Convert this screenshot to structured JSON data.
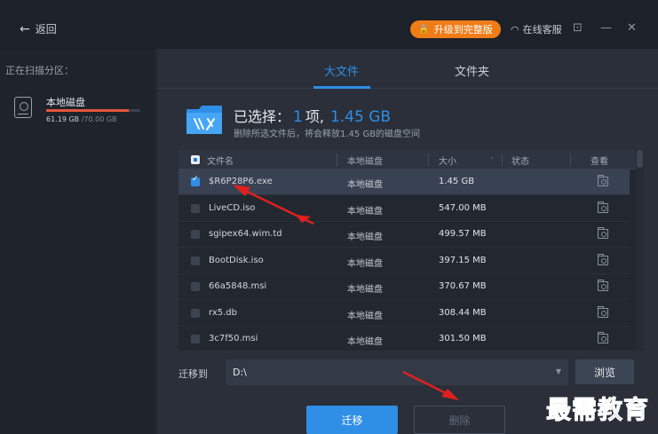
{
  "titlebar": {
    "back_label": "返回",
    "upgrade_label": "升级到完整版",
    "service_label": "在线客服"
  },
  "left_panel": {
    "scan_title": "正在扫描分区：",
    "disk": {
      "name": "本地磁盘",
      "used": "61.19 GB",
      "total": "/70.00 GB",
      "usage_fraction": 0.874
    }
  },
  "tabs": [
    {
      "label": "大文件",
      "active": true
    },
    {
      "label": "文件夹",
      "active": false
    }
  ],
  "selection": {
    "prefix": "已选择：",
    "count": "1",
    "unit": "项,",
    "size": "1.45 GB",
    "note": "删除所选文件后，将会释放1.45 GB的磁盘空间"
  },
  "table": {
    "headers": {
      "name": "文件名",
      "location": "本地磁盘",
      "size": "大小",
      "status": "状态",
      "view": "查看"
    },
    "rows": [
      {
        "name": "$R6P28P6.exe",
        "location": "本地磁盘",
        "size": "1.45 GB",
        "checked": true
      },
      {
        "name": "LiveCD.iso",
        "location": "本地磁盘",
        "size": "547.00 MB",
        "checked": false
      },
      {
        "name": "sgipex64.wim.td",
        "location": "本地磁盘",
        "size": "499.57 MB",
        "checked": false
      },
      {
        "name": "BootDisk.iso",
        "location": "本地磁盘",
        "size": "397.15 MB",
        "checked": false
      },
      {
        "name": "66a5848.msi",
        "location": "本地磁盘",
        "size": "370.67 MB",
        "checked": false
      },
      {
        "name": "rx5.db",
        "location": "本地磁盘",
        "size": "308.44 MB",
        "checked": false
      },
      {
        "name": "3c7f50.msi",
        "location": "本地磁盘",
        "size": "301.50 MB",
        "checked": false
      }
    ]
  },
  "move": {
    "label": "迁移到",
    "path": "D:\\",
    "browse_label": "浏览"
  },
  "actions": {
    "migrate_label": "迁移",
    "delete_label": "删除"
  },
  "watermark": "最需教育",
  "colors": {
    "accent": "#2f8ee6",
    "upgrade": "#f07c18",
    "annotation": "#e0201f"
  }
}
